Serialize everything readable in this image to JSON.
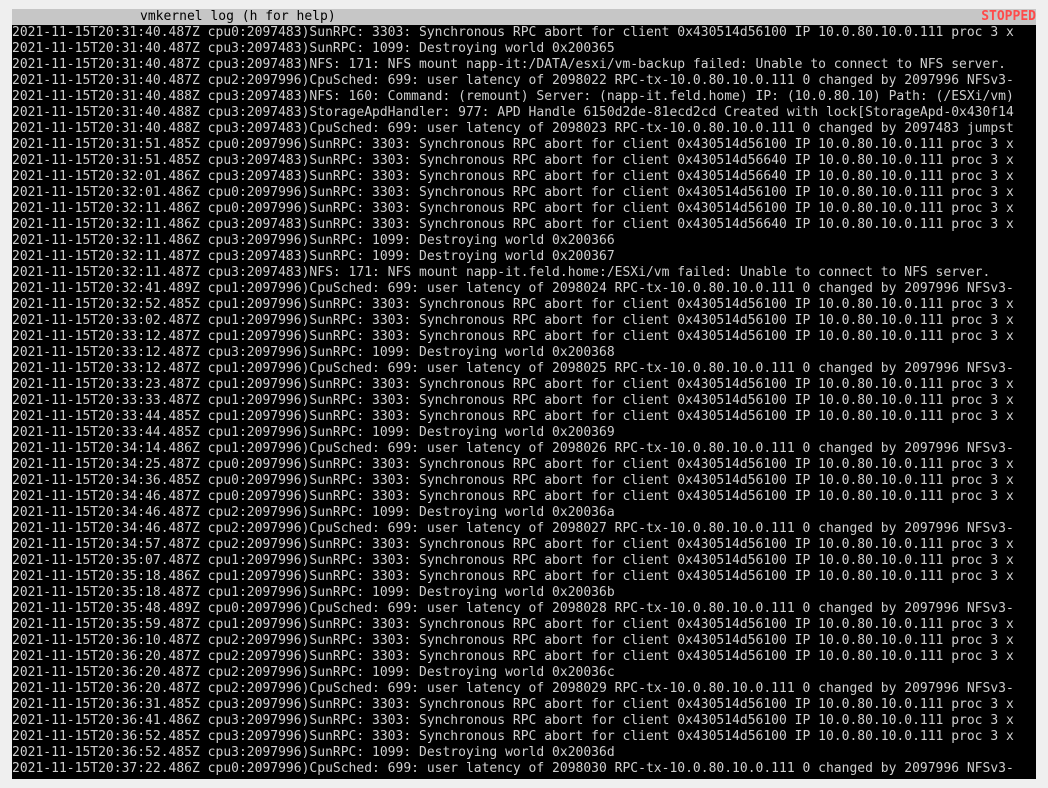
{
  "window": {
    "title": "vmkernel log (h for help)",
    "status": "STOPPED",
    "status_color": "#ff4a4a",
    "background_color": "#000000",
    "text_color": "#cfcfcf",
    "titlebar_color": "#c6c6c6"
  },
  "log_lines": [
    "2021-11-15T20:31:40.487Z cpu0:2097483)SunRPC: 3303: Synchronous RPC abort for client 0x430514d56100 IP 10.0.80.10.0.111 proc 3 x",
    "2021-11-15T20:31:40.487Z cpu3:2097483)SunRPC: 1099: Destroying world 0x200365",
    "2021-11-15T20:31:40.487Z cpu3:2097483)NFS: 171: NFS mount napp-it:/DATA/esxi/vm-backup failed: Unable to connect to NFS server.",
    "2021-11-15T20:31:40.487Z cpu2:2097996)CpuSched: 699: user latency of 2098022 RPC-tx-10.0.80.10.0.111 0 changed by 2097996 NFSv3-",
    "2021-11-15T20:31:40.488Z cpu3:2097483)NFS: 160: Command: (remount) Server: (napp-it.feld.home) IP: (10.0.80.10) Path: (/ESXi/vm)",
    "2021-11-15T20:31:40.488Z cpu3:2097483)StorageApdHandler: 977: APD Handle 6150d2de-81ecd2cd Created with lock[StorageApd-0x430f14",
    "2021-11-15T20:31:40.488Z cpu3:2097483)CpuSched: 699: user latency of 2098023 RPC-tx-10.0.80.10.0.111 0 changed by 2097483 jumpst",
    "2021-11-15T20:31:51.485Z cpu0:2097996)SunRPC: 3303: Synchronous RPC abort for client 0x430514d56100 IP 10.0.80.10.0.111 proc 3 x",
    "2021-11-15T20:31:51.485Z cpu3:2097483)SunRPC: 3303: Synchronous RPC abort for client 0x430514d56640 IP 10.0.80.10.0.111 proc 3 x",
    "2021-11-15T20:32:01.486Z cpu3:2097483)SunRPC: 3303: Synchronous RPC abort for client 0x430514d56640 IP 10.0.80.10.0.111 proc 3 x",
    "2021-11-15T20:32:01.486Z cpu0:2097996)SunRPC: 3303: Synchronous RPC abort for client 0x430514d56100 IP 10.0.80.10.0.111 proc 3 x",
    "2021-11-15T20:32:11.486Z cpu0:2097996)SunRPC: 3303: Synchronous RPC abort for client 0x430514d56100 IP 10.0.80.10.0.111 proc 3 x",
    "2021-11-15T20:32:11.486Z cpu3:2097483)SunRPC: 3303: Synchronous RPC abort for client 0x430514d56640 IP 10.0.80.10.0.111 proc 3 x",
    "2021-11-15T20:32:11.486Z cpu3:2097996)SunRPC: 1099: Destroying world 0x200366",
    "2021-11-15T20:32:11.487Z cpu3:2097483)SunRPC: 1099: Destroying world 0x200367",
    "2021-11-15T20:32:11.487Z cpu3:2097483)NFS: 171: NFS mount napp-it.feld.home:/ESXi/vm failed: Unable to connect to NFS server.",
    "2021-11-15T20:32:41.489Z cpu1:2097996)CpuSched: 699: user latency of 2098024 RPC-tx-10.0.80.10.0.111 0 changed by 2097996 NFSv3-",
    "2021-11-15T20:32:52.485Z cpu1:2097996)SunRPC: 3303: Synchronous RPC abort for client 0x430514d56100 IP 10.0.80.10.0.111 proc 3 x",
    "2021-11-15T20:33:02.487Z cpu1:2097996)SunRPC: 3303: Synchronous RPC abort for client 0x430514d56100 IP 10.0.80.10.0.111 proc 3 x",
    "2021-11-15T20:33:12.487Z cpu1:2097996)SunRPC: 3303: Synchronous RPC abort for client 0x430514d56100 IP 10.0.80.10.0.111 proc 3 x",
    "2021-11-15T20:33:12.487Z cpu3:2097996)SunRPC: 1099: Destroying world 0x200368",
    "2021-11-15T20:33:12.487Z cpu1:2097996)CpuSched: 699: user latency of 2098025 RPC-tx-10.0.80.10.0.111 0 changed by 2097996 NFSv3-",
    "2021-11-15T20:33:23.487Z cpu1:2097996)SunRPC: 3303: Synchronous RPC abort for client 0x430514d56100 IP 10.0.80.10.0.111 proc 3 x",
    "2021-11-15T20:33:33.487Z cpu1:2097996)SunRPC: 3303: Synchronous RPC abort for client 0x430514d56100 IP 10.0.80.10.0.111 proc 3 x",
    "2021-11-15T20:33:44.485Z cpu1:2097996)SunRPC: 3303: Synchronous RPC abort for client 0x430514d56100 IP 10.0.80.10.0.111 proc 3 x",
    "2021-11-15T20:33:44.485Z cpu1:2097996)SunRPC: 1099: Destroying world 0x200369",
    "2021-11-15T20:34:14.486Z cpu1:2097996)CpuSched: 699: user latency of 2098026 RPC-tx-10.0.80.10.0.111 0 changed by 2097996 NFSv3-",
    "2021-11-15T20:34:25.487Z cpu0:2097996)SunRPC: 3303: Synchronous RPC abort for client 0x430514d56100 IP 10.0.80.10.0.111 proc 3 x",
    "2021-11-15T20:34:36.485Z cpu0:2097996)SunRPC: 3303: Synchronous RPC abort for client 0x430514d56100 IP 10.0.80.10.0.111 proc 3 x",
    "2021-11-15T20:34:46.487Z cpu0:2097996)SunRPC: 3303: Synchronous RPC abort for client 0x430514d56100 IP 10.0.80.10.0.111 proc 3 x",
    "2021-11-15T20:34:46.487Z cpu2:2097996)SunRPC: 1099: Destroying world 0x20036a",
    "2021-11-15T20:34:46.487Z cpu2:2097996)CpuSched: 699: user latency of 2098027 RPC-tx-10.0.80.10.0.111 0 changed by 2097996 NFSv3-",
    "2021-11-15T20:34:57.487Z cpu2:2097996)SunRPC: 3303: Synchronous RPC abort for client 0x430514d56100 IP 10.0.80.10.0.111 proc 3 x",
    "2021-11-15T20:35:07.487Z cpu1:2097996)SunRPC: 3303: Synchronous RPC abort for client 0x430514d56100 IP 10.0.80.10.0.111 proc 3 x",
    "2021-11-15T20:35:18.486Z cpu1:2097996)SunRPC: 3303: Synchronous RPC abort for client 0x430514d56100 IP 10.0.80.10.0.111 proc 3 x",
    "2021-11-15T20:35:18.487Z cpu1:2097996)SunRPC: 1099: Destroying world 0x20036b",
    "2021-11-15T20:35:48.489Z cpu0:2097996)CpuSched: 699: user latency of 2098028 RPC-tx-10.0.80.10.0.111 0 changed by 2097996 NFSv3-",
    "2021-11-15T20:35:59.487Z cpu1:2097996)SunRPC: 3303: Synchronous RPC abort for client 0x430514d56100 IP 10.0.80.10.0.111 proc 3 x",
    "2021-11-15T20:36:10.487Z cpu2:2097996)SunRPC: 3303: Synchronous RPC abort for client 0x430514d56100 IP 10.0.80.10.0.111 proc 3 x",
    "2021-11-15T20:36:20.487Z cpu2:2097996)SunRPC: 3303: Synchronous RPC abort for client 0x430514d56100 IP 10.0.80.10.0.111 proc 3 x",
    "2021-11-15T20:36:20.487Z cpu2:2097996)SunRPC: 1099: Destroying world 0x20036c",
    "2021-11-15T20:36:20.487Z cpu2:2097996)CpuSched: 699: user latency of 2098029 RPC-tx-10.0.80.10.0.111 0 changed by 2097996 NFSv3-",
    "2021-11-15T20:36:31.485Z cpu3:2097996)SunRPC: 3303: Synchronous RPC abort for client 0x430514d56100 IP 10.0.80.10.0.111 proc 3 x",
    "2021-11-15T20:36:41.486Z cpu3:2097996)SunRPC: 3303: Synchronous RPC abort for client 0x430514d56100 IP 10.0.80.10.0.111 proc 3 x",
    "2021-11-15T20:36:52.485Z cpu3:2097996)SunRPC: 3303: Synchronous RPC abort for client 0x430514d56100 IP 10.0.80.10.0.111 proc 3 x",
    "2021-11-15T20:36:52.485Z cpu3:2097996)SunRPC: 1099: Destroying world 0x20036d",
    "2021-11-15T20:37:22.486Z cpu0:2097996)CpuSched: 699: user latency of 2098030 RPC-tx-10.0.80.10.0.111 0 changed by 2097996 NFSv3-"
  ]
}
